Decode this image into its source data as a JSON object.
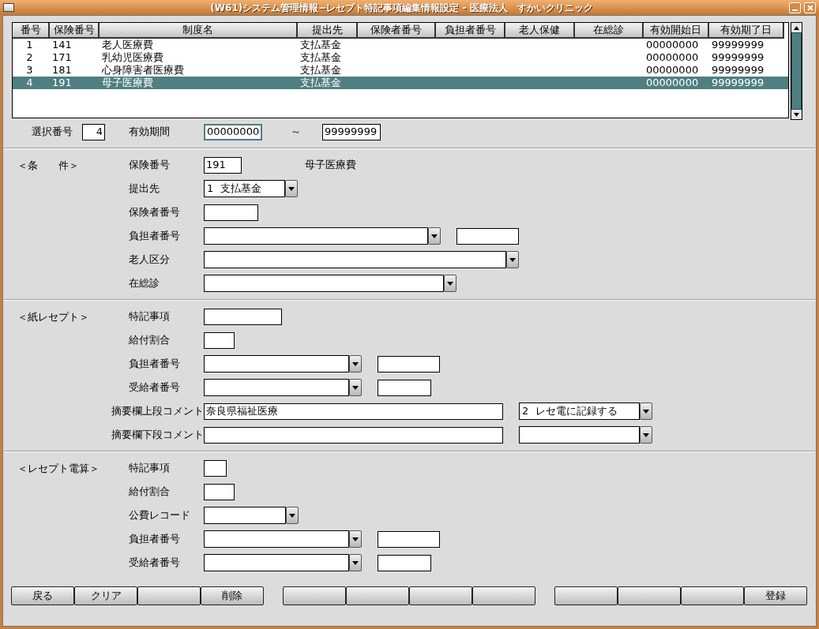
{
  "window": {
    "title": "(W61)システム管理情報−レセプト特記事項編集情報設定 - 医療法人　すかいクリニック"
  },
  "table": {
    "columns": [
      "番号",
      "保険番号",
      "制度名",
      "提出先",
      "保険者番号",
      "負担者番号",
      "老人保健",
      "在総診",
      "有効開始日",
      "有効期了日"
    ],
    "rows": [
      {
        "selected": false,
        "cells": [
          "1",
          "141",
          "老人医療費",
          "支払基金",
          "",
          "",
          "",
          "",
          "00000000",
          "99999999"
        ]
      },
      {
        "selected": false,
        "cells": [
          "2",
          "171",
          "乳幼児医療費",
          "支払基金",
          "",
          "",
          "",
          "",
          "00000000",
          "99999999"
        ]
      },
      {
        "selected": false,
        "cells": [
          "3",
          "181",
          "心身障害者医療費",
          "支払基金",
          "",
          "",
          "",
          "",
          "00000000",
          "99999999"
        ]
      },
      {
        "selected": true,
        "cells": [
          "4",
          "191",
          "母子医療費",
          "支払基金",
          "",
          "",
          "",
          "",
          "00000000",
          "99999999"
        ]
      }
    ]
  },
  "selection": {
    "number_label": "選択番号",
    "number": "4",
    "period_label": "有効期間",
    "start": {
      "value": "00000000",
      "focused": true
    },
    "separator": "～",
    "end": {
      "value": "99999999",
      "focused": false
    }
  },
  "sections": [
    {
      "title": "＜条　　件＞",
      "rows": [
        {
          "label": "保険番号",
          "controls": [
            {
              "kind": "input",
              "value": "191"
            },
            {
              "kind": "text",
              "value": "母子医療費"
            }
          ]
        },
        {
          "label": "提出先",
          "controls": [
            {
              "kind": "select",
              "value": "1  支払基金"
            }
          ]
        },
        {
          "label": "保険者番号",
          "controls": [
            {
              "kind": "input"
            }
          ]
        },
        {
          "label": "負担者番号",
          "controls": [
            {
              "kind": "select"
            },
            {
              "kind": "input"
            }
          ]
        },
        {
          "label": "老人区分",
          "controls": [
            {
              "kind": "select"
            }
          ]
        },
        {
          "label": "在総診",
          "controls": [
            {
              "kind": "select"
            }
          ]
        }
      ]
    },
    {
      "title": "＜紙レセプト＞",
      "rows": [
        {
          "label": "特記事項",
          "controls": [
            {
              "kind": "input"
            }
          ]
        },
        {
          "label": "給付割合",
          "controls": [
            {
              "kind": "input"
            }
          ]
        },
        {
          "label": "負担者番号",
          "controls": [
            {
              "kind": "select"
            },
            {
              "kind": "input"
            }
          ]
        },
        {
          "label": "受給者番号",
          "controls": [
            {
              "kind": "select"
            },
            {
              "kind": "input"
            }
          ]
        },
        {
          "label": "摘要欄上段コメント",
          "controls": [
            {
              "kind": "input",
              "value": "奈良県福祉医療"
            },
            {
              "kind": "select",
              "value": "2  レセ電に記録する"
            }
          ]
        },
        {
          "label": "摘要欄下段コメント",
          "controls": [
            {
              "kind": "input"
            },
            {
              "kind": "select"
            }
          ]
        }
      ]
    },
    {
      "title": "＜レセプト電算＞",
      "rows": [
        {
          "label": "特記事項",
          "controls": [
            {
              "kind": "input"
            }
          ]
        },
        {
          "label": "給付割合",
          "controls": [
            {
              "kind": "input"
            }
          ]
        },
        {
          "label": "公費レコード",
          "controls": [
            {
              "kind": "select"
            }
          ]
        },
        {
          "label": "負担者番号",
          "controls": [
            {
              "kind": "select"
            },
            {
              "kind": "input"
            }
          ]
        },
        {
          "label": "受給者番号",
          "controls": [
            {
              "kind": "select"
            },
            {
              "kind": "input"
            }
          ]
        }
      ]
    }
  ],
  "buttons": [
    [
      {
        "kind": "labeled",
        "label": "戻る"
      },
      {
        "kind": "labeled",
        "label": "クリア"
      },
      {
        "kind": "blank"
      },
      {
        "kind": "labeled",
        "label": "削除"
      }
    ],
    [
      {
        "kind": "blank"
      },
      {
        "kind": "blank"
      },
      {
        "kind": "blank"
      },
      {
        "kind": "blank"
      }
    ],
    [
      {
        "kind": "blank"
      },
      {
        "kind": "blank"
      },
      {
        "kind": "blank"
      },
      {
        "kind": "labeled",
        "label": "登録"
      }
    ]
  ]
}
